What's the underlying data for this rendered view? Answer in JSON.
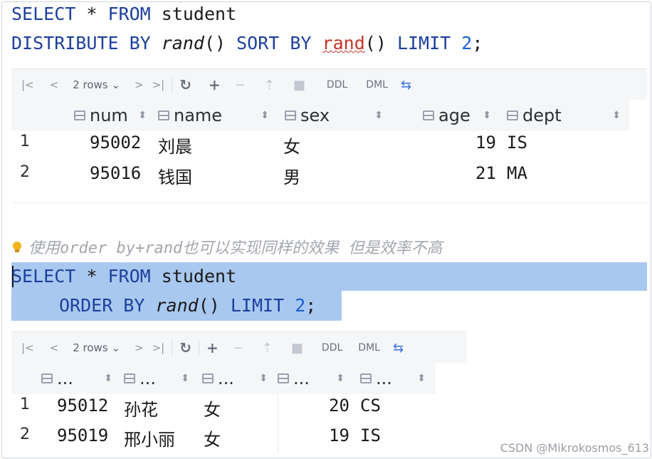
{
  "query1": {
    "line1": {
      "kw1": "SELECT",
      "star": "*",
      "kw2": "FROM",
      "table": "student"
    },
    "line2": {
      "kw1": "DISTRIBUTE BY",
      "fn1": "rand",
      "paren1": "()",
      "kw2": "SORT BY",
      "fn2": "rand",
      "paren2": "()",
      "kw3": "LIMIT",
      "num": "2",
      "semi": ";"
    }
  },
  "toolbar1": {
    "first": "|<",
    "prev": "<",
    "rows": "2 rows",
    "rows_arrow": "⌄",
    "next": ">",
    "last": ">|",
    "refresh": "↻",
    "add": "+",
    "remove": "−",
    "revert": "⇡",
    "stop": "■",
    "ddl": "DDL",
    "dml": "DML",
    "compare": "⇆"
  },
  "grid1": {
    "columns": [
      {
        "label": "num",
        "sort": "⬍"
      },
      {
        "label": "name",
        "sort": "⬍"
      },
      {
        "label": "sex",
        "sort": "⬍"
      },
      {
        "label": "age",
        "sort": "⬍"
      },
      {
        "label": "dept",
        "sort": "⬍"
      }
    ],
    "rows": [
      {
        "no": "1",
        "num": "95002",
        "name": "刘晨",
        "sex": "女",
        "age": "19",
        "dept": "IS"
      },
      {
        "no": "2",
        "num": "95016",
        "name": "钱国",
        "sex": "男",
        "age": "21",
        "dept": "MA"
      }
    ]
  },
  "comment": "使用order by+rand也可以实现同样的效果 但是效率不高",
  "query2": {
    "line1": {
      "kw1": "SELECT",
      "star": "*",
      "kw2": "FROM",
      "table": "student"
    },
    "line2": {
      "kw1": "ORDER BY",
      "fn": "rand",
      "paren": "()",
      "kw2": "LIMIT",
      "num": "2",
      "semi": ";"
    }
  },
  "toolbar2": {
    "first": "|<",
    "prev": "<",
    "rows": "2 rows",
    "rows_arrow": "⌄",
    "next": ">",
    "last": ">|",
    "refresh": "↻",
    "add": "+",
    "remove": "−",
    "revert": "⇡",
    "stop": "■",
    "ddl": "DDL",
    "dml": "DML",
    "compare": "⇆"
  },
  "grid2": {
    "columns": [
      {
        "label": "...",
        "sort": "⬍"
      },
      {
        "label": "...",
        "sort": "⬍"
      },
      {
        "label": "...",
        "sort": "⬍"
      },
      {
        "label": "...",
        "sort": "⬍"
      },
      {
        "label": "...",
        "sort": "⬍"
      }
    ],
    "rows": [
      {
        "no": "1",
        "num": "95012",
        "name": "孙花",
        "sex": "女",
        "age": "20",
        "dept": "CS"
      },
      {
        "no": "2",
        "num": "95019",
        "name": "邢小丽",
        "sex": "女",
        "age": "19",
        "dept": "IS"
      }
    ]
  },
  "watermark": "CSDN @Mikrokosmos_613"
}
